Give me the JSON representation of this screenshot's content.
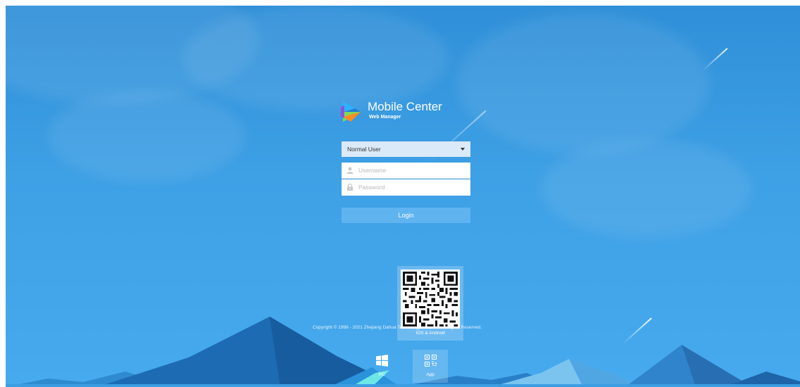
{
  "app": {
    "title": "Mobile Center",
    "subtitle": "Web Manager"
  },
  "login": {
    "role_selected": "Normal User",
    "username_placeholder": "Username",
    "password_placeholder": "Password",
    "login_label": "Login"
  },
  "footer": {
    "copyright": "Copyright © 1998 - 2021 Zhejiang Dahua Technology Co., Ltd. All Rights Reserved.",
    "qr_caption": "IOS & Android",
    "downloads": [
      {
        "label": "PC",
        "icon": "windows-icon"
      },
      {
        "label": "App",
        "icon": "qr-code-icon"
      }
    ]
  },
  "colors": {
    "background": "#3a9be2",
    "login_button": "#5fb4f0",
    "select_background": "#dbeaf8"
  }
}
